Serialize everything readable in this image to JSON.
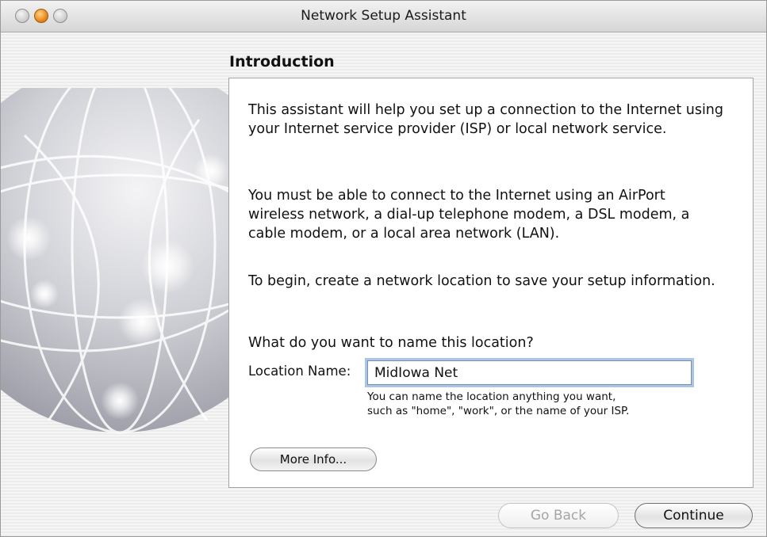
{
  "window": {
    "title": "Network Setup Assistant",
    "buttons": [
      "close",
      "minimize",
      "zoom"
    ]
  },
  "illustration": {
    "icon": "network-globe-icon"
  },
  "section": {
    "title": "Introduction"
  },
  "body": {
    "paragraph1": "This assistant will help you set up a connection to the Internet using your Internet service provider (ISP) or local network service.",
    "paragraph2": "You must be able to connect to the Internet using an AirPort wireless network, a dial-up telephone modem, a DSL modem, a cable modem, or a local area network (LAN).",
    "paragraph3": "To begin, create a network location to save your setup information.",
    "question": "What do you want to name this location?"
  },
  "location": {
    "label": "Location Name:",
    "value": "MidIowa Net",
    "hint_line1": "You can name the location anything you want,",
    "hint_line2": "such as \"home\", \"work\", or the name of your ISP."
  },
  "buttons": {
    "more_info": "More Info...",
    "go_back": "Go Back",
    "continue": "Continue"
  }
}
